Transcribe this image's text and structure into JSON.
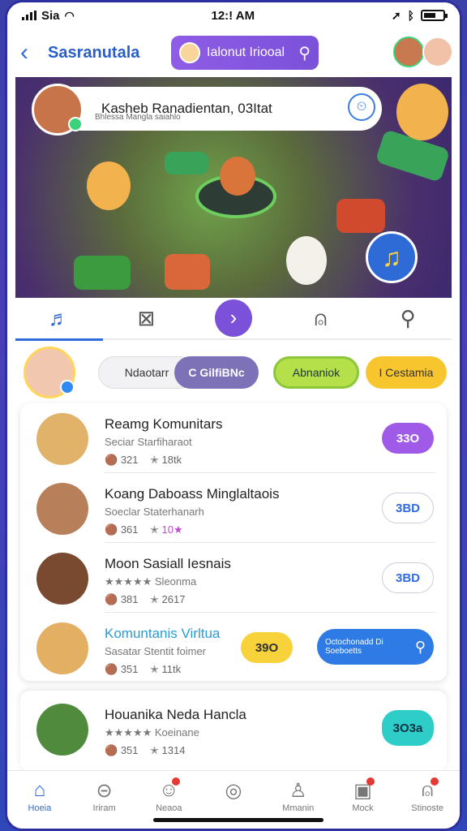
{
  "status": {
    "carrier": "Sia",
    "time": "12:! AM"
  },
  "header": {
    "title": "Sasranutala",
    "search_label": "Ialonut Iriooal"
  },
  "hero": {
    "name_line": "Kasheb Ranadientan, 03Itat",
    "sub_line": "Bhlessa Mangla saiahlo"
  },
  "chips": [
    {
      "label": "Ndaotarr"
    },
    {
      "label": "C GilfiBNc"
    },
    {
      "label": "Abnaniok"
    },
    {
      "label": "I Cestamia"
    }
  ],
  "list": [
    {
      "name": "Reamg Komunitars",
      "sub": "Seciar  Starfiharaot",
      "meta1": "321",
      "meta2": "18tk",
      "button": "33O"
    },
    {
      "name": "Koang Daboass Minglaltaois",
      "sub": "Soeclar  Staterhanarh",
      "meta1": "361",
      "meta2": "10★",
      "button": "3BD"
    },
    {
      "name": "Moon Sasiall Iesnais",
      "sub": "★★★★★  Sleonma",
      "meta1": "381",
      "meta2": "2617",
      "button": "3BD"
    },
    {
      "name": "Komuntanis Virltua",
      "sub": "Sasatar  Stentit foimer",
      "meta1": "351",
      "meta2": "11tk",
      "button": "39O",
      "extra_button": "Octochonadd Di Soeboetts"
    }
  ],
  "card2": {
    "name": "Houanika Neda Hancla",
    "sub": "★★★★★  Koeinane",
    "meta1": "351",
    "meta2": "1314",
    "button": "3O3a"
  },
  "bottom_nav": [
    {
      "label": "Hoeia"
    },
    {
      "label": "Iriram"
    },
    {
      "label": "Neaoa"
    },
    {
      "label": ""
    },
    {
      "label": "Mmanin"
    },
    {
      "label": "Mock"
    },
    {
      "label": "Stinoste"
    }
  ],
  "colors": {
    "accent": "#2f6bdc",
    "purple": "#7b51d9",
    "green": "#b5e04a",
    "yellow": "#f7c52e",
    "teal": "#2fcdc8"
  }
}
